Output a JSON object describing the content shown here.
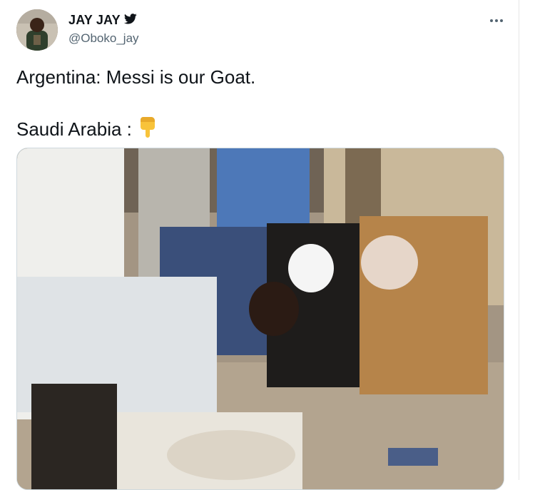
{
  "author": {
    "display_name": "JAY JAY",
    "handle": "@Oboko_jay",
    "verified_icon": "twitter-bird-icon"
  },
  "menu": {
    "icon": "more-horizontal-icon"
  },
  "tweet": {
    "line1": "Argentina: Messi is our Goat.",
    "line2_text": "Saudi Arabia :",
    "line2_emoji": "👇"
  },
  "media": {
    "type": "photo"
  },
  "colors": {
    "text": "#0f1419",
    "secondary": "#536471",
    "border": "#cfd9de"
  }
}
